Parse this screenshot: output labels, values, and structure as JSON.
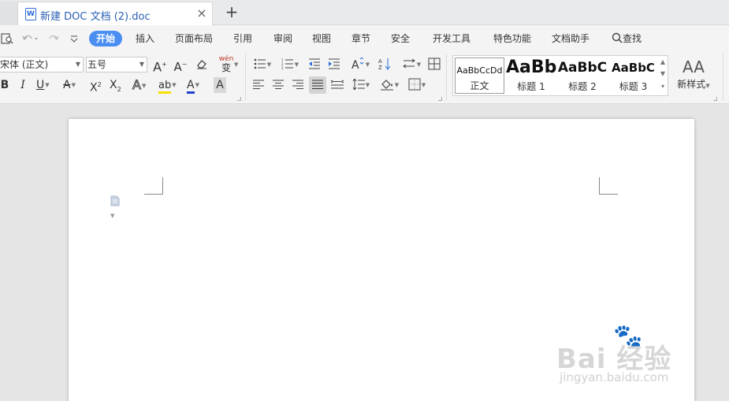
{
  "tabs": {
    "doc_icon_letter": "W",
    "doc_title": "新建 DOC 文档 (2).doc",
    "close_glyph": "×",
    "add_glyph": "+"
  },
  "quick_access": {
    "print_preview_icon": "print-preview-icon",
    "undo_icon": "undo-icon",
    "redo_icon": "redo-icon",
    "more_icon": "customize-icon"
  },
  "menu": {
    "items": [
      "开始",
      "插入",
      "页面布局",
      "引用",
      "审阅",
      "视图",
      "章节",
      "安全",
      "开发工具",
      "特色功能",
      "文档助手"
    ],
    "active_index": 0,
    "search_label": "查找"
  },
  "ribbon": {
    "font_name": "宋体 (正文)",
    "font_size": "五号",
    "grow_font": "A",
    "shrink_font": "A",
    "phonetic_label": "wén",
    "phonetic_char": "变",
    "bold": "B",
    "italic": "I",
    "underline": "U",
    "strike": "A",
    "superscript": "X",
    "subscript": "X",
    "text_effect": "A",
    "highlight": "ab",
    "font_color": "A",
    "char_shading": "A",
    "font_color_value": "#1f3fd0",
    "highlight_color_value": "#f5e000",
    "accent_color": "#4a8ef1"
  },
  "styles": {
    "items": [
      {
        "sample": "AaBbCcDd",
        "label": "正文"
      },
      {
        "sample": "AaBb",
        "label": "标题 1"
      },
      {
        "sample": "AaBbC",
        "label": "标题 2"
      },
      {
        "sample": "AaBbC",
        "label": "标题 3"
      }
    ],
    "new_style_icon": "AA",
    "new_style_label": "新样式"
  },
  "document": {
    "paragraph_icon": "paragraph-marker-icon"
  },
  "watermark": {
    "brand": "Bai 经验",
    "domain": "jingyan.baidu.com"
  }
}
